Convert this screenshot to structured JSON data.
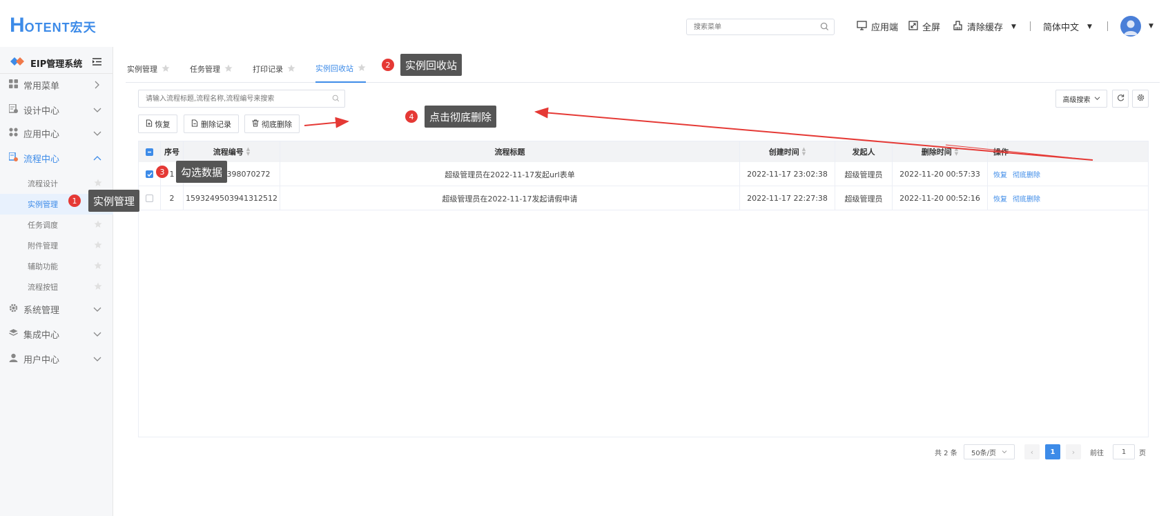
{
  "header": {
    "logo_h": "H",
    "logo_rest": "OTENT宏天",
    "search_placeholder": "搜索菜单",
    "app_label": "应用端",
    "fullscreen_label": "全屏",
    "clear_cache_label": "清除缓存",
    "language_label": "简体中文"
  },
  "sidebar": {
    "system_title": "EIP管理系统",
    "menus": [
      {
        "label": "常用菜单",
        "icon": "grid-icon"
      },
      {
        "label": "设计中心",
        "icon": "design-icon"
      },
      {
        "label": "应用中心",
        "icon": "apps-icon"
      },
      {
        "label": "流程中心",
        "icon": "flow-icon"
      },
      {
        "label": "系统管理",
        "icon": "gear-icon"
      },
      {
        "label": "集成中心",
        "icon": "layers-icon"
      },
      {
        "label": "用户中心",
        "icon": "user-icon"
      }
    ],
    "submenus": [
      "流程设计",
      "实例管理",
      "任务调度",
      "附件管理",
      "辅助功能",
      "流程按钮"
    ]
  },
  "tabs": [
    "实例管理",
    "任务管理",
    "打印记录",
    "实例回收站"
  ],
  "toolbar": {
    "search_placeholder": "请输入流程标题,流程名称,流程编号来搜索",
    "advanced_search": "高级搜索",
    "restore": "恢复",
    "delete_records": "删除记录",
    "purge": "彻底删除"
  },
  "table": {
    "headers": [
      "序号",
      "流程编号",
      "流程标题",
      "创建时间",
      "发起人",
      "删除时间",
      "操作"
    ],
    "rows": [
      {
        "index": "1",
        "code": "1593315398070272",
        "title": "超级管理员在2022-11-17发起url表单",
        "created": "2022-11-17 23:02:38",
        "initiator": "超级管理员",
        "deleted": "2022-11-20 00:57:33",
        "op_restore": "恢复",
        "op_purge": "彻底删除",
        "checked": true
      },
      {
        "index": "2",
        "code": "1593249503941312512",
        "title": "超级管理员在2022-11-17发起请假申请",
        "created": "2022-11-17 22:27:38",
        "initiator": "超级管理员",
        "deleted": "2022-11-20 00:52:16",
        "op_restore": "恢复",
        "op_purge": "彻底删除",
        "checked": false
      }
    ]
  },
  "pagination": {
    "total": "共 2 条",
    "page_size": "50条/页",
    "current_page": "1",
    "goto_label": "前往",
    "goto_value": "1",
    "page_suffix": "页"
  },
  "annotations": [
    {
      "num": "1",
      "text": "实例管理"
    },
    {
      "num": "2",
      "text": "实例回收站"
    },
    {
      "num": "3",
      "text": "勾选数据"
    },
    {
      "num": "4",
      "text": "点击彻底删除"
    }
  ],
  "colors": {
    "accent": "#3d8be8",
    "annotation_red": "#e53935",
    "callout_bg": "#555555"
  }
}
